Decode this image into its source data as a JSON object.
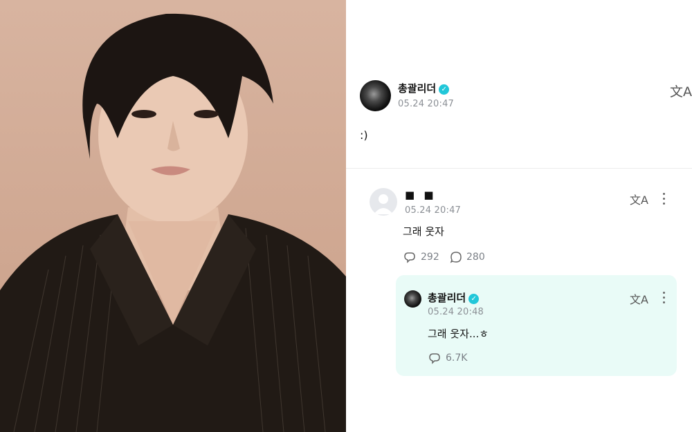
{
  "post": {
    "author": "총괄리더",
    "timestamp": "05.24 20:47",
    "text": ":)"
  },
  "comment": {
    "author": "■ ■",
    "timestamp": "05.24 20:47",
    "text": "그래 웃자",
    "likes": "292",
    "replies": "280"
  },
  "reply": {
    "author": "총괄리더",
    "timestamp": "05.24 20:48",
    "text": "그래 웃자...ㅎ",
    "likes": "6.7K"
  },
  "colors": {
    "verified": "#21c7d9",
    "reply_bg": "#e9fbf7",
    "time": "#8b8f95"
  },
  "icons": [
    "verified-icon",
    "translate-icon",
    "more-vert-icon",
    "like-icon",
    "comment-icon"
  ]
}
